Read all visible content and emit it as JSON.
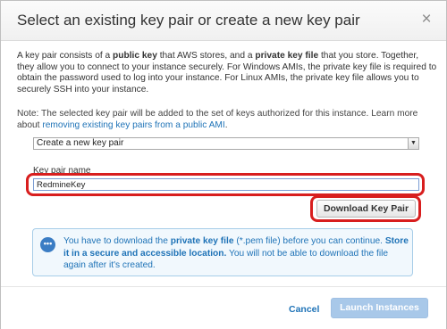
{
  "dialog": {
    "title": "Select an existing key pair or create a new key pair",
    "close_glyph": "×"
  },
  "description": {
    "t1": "A key pair consists of a ",
    "b1": "public key",
    "t2": " that AWS stores, and a ",
    "b2": "private key file",
    "t3": " that you store. Together, they allow you to connect to your instance securely. For Windows AMIs, the private key file is required to obtain the password used to log into your instance. For Linux AMIs, the private key file allows you to securely SSH into your instance."
  },
  "note": {
    "text": "Note: The selected key pair will be added to the set of keys authorized for this instance. Learn more about ",
    "link": "removing existing key pairs from a public AMI",
    "end": "."
  },
  "key_pair_select": {
    "selected": "Create a new key pair",
    "arrow": "▼"
  },
  "key_pair_name": {
    "label": "Key pair name",
    "value": "RedmineKey"
  },
  "download_button": {
    "label": "Download Key Pair"
  },
  "info_box": {
    "icon": "•••",
    "t1": "You have to download the ",
    "b1": "private key file",
    "t2": " (*.pem file) before you can continue. ",
    "b2": "Store it in a secure and accessible location.",
    "t3": " You will not be able to download the file again after it's created."
  },
  "footer": {
    "cancel_label": "Cancel",
    "launch_label": "Launch Instances"
  },
  "colors": {
    "accent": "#1f73b7",
    "highlight": "#d81e1e",
    "launch_disabled": "#a8c8e9"
  }
}
